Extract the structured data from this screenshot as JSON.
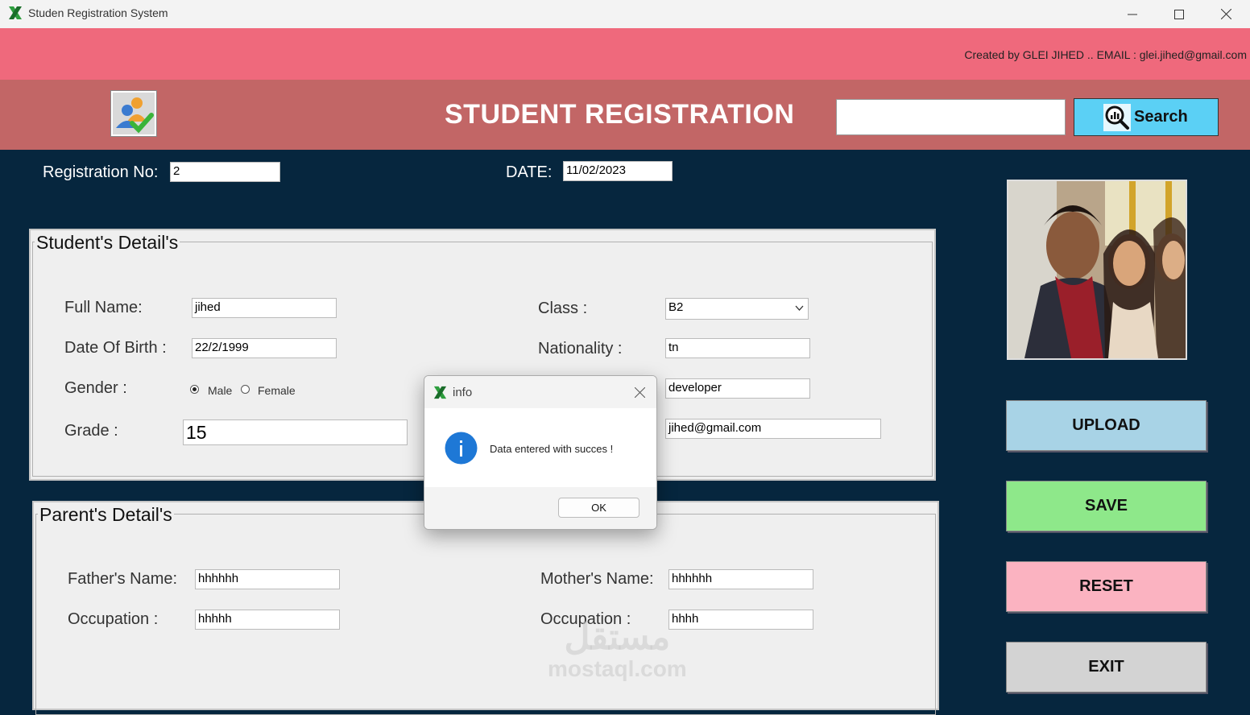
{
  "window": {
    "title": "Studen Registration System"
  },
  "credits": "Created by GLEI JIHED .. EMAIL : glei.jihed@gmail.com",
  "header": {
    "title": "STUDENT REGISTRATION",
    "search_value": "",
    "search_label": "Search"
  },
  "top_fields": {
    "registration_label": "Registration No:",
    "registration_value": "2",
    "date_label": "DATE:",
    "date_value": "11/02/2023"
  },
  "student": {
    "title": "Student's Detail's",
    "full_name_label": "Full Name:",
    "full_name": "jihed",
    "dob_label": "Date Of Birth :",
    "dob": "22/2/1999",
    "gender_label": "Gender :",
    "gender_options": [
      "Male",
      "Female"
    ],
    "gender_selected": "Male",
    "grade_label": "Grade :",
    "grade": "15",
    "class_label": "Class :",
    "class": "B2",
    "nationality_label": "Nationality :",
    "nationality": "tn",
    "occupation": "developer",
    "email": "jihed@gmail.com"
  },
  "parent": {
    "title": "Parent's Detail's",
    "father_label": "Father's Name:",
    "father": "hhhhhh",
    "father_occ_label": "Occupation :",
    "father_occ": "hhhhh",
    "mother_label": "Mother's Name:",
    "mother": "hhhhhh",
    "mother_occ_label": "Occupation :",
    "mother_occ": "hhhh"
  },
  "actions": {
    "upload": "UPLOAD",
    "save": "SAVE",
    "reset": "RESET",
    "exit": "EXIT"
  },
  "dialog": {
    "title": "info",
    "message": "Data entered with succes !",
    "ok": "OK"
  },
  "watermark": {
    "arabic": "مستقل",
    "latin": "mostaql.com"
  },
  "colors": {
    "background": "#06263e",
    "pink_bar": "#ef697c",
    "header": "#c26666",
    "upload": "#a8d3e6",
    "save": "#8ee88a",
    "reset": "#fbb3c1",
    "exit": "#d3d3d3",
    "search": "#5bd0f5"
  }
}
